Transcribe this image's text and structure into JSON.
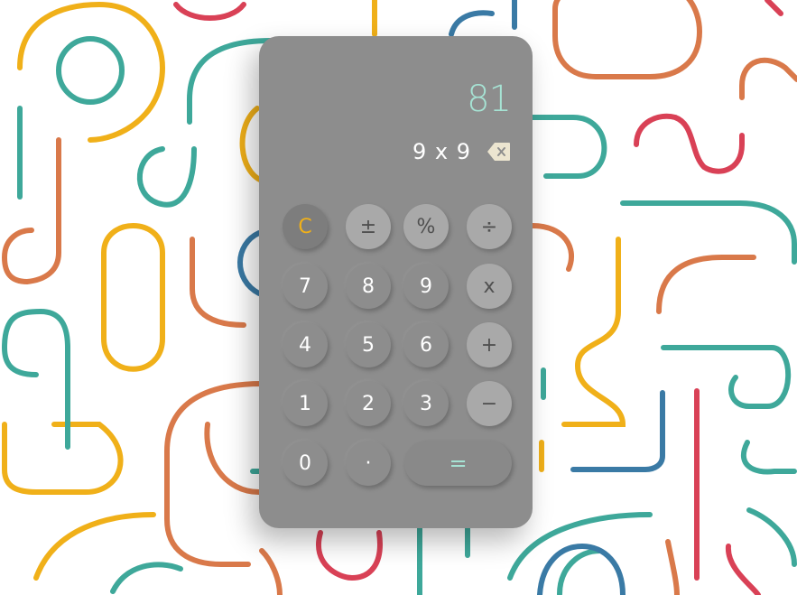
{
  "calculator": {
    "result": "81",
    "expression": "9 x 9",
    "backspace_icon": "backspace-icon",
    "colors": {
      "body": "#8d8d8d",
      "result_text": "#a6e3d4",
      "clear_key_text": "#f0b019",
      "equals_text": "#a6e3d4",
      "operator_key": "#a9a9a9"
    },
    "keys": {
      "clear": "C",
      "sign": "±",
      "percent": "%",
      "divide": "÷",
      "seven": "7",
      "eight": "8",
      "nine": "9",
      "multiply": "x",
      "four": "4",
      "five": "5",
      "six": "6",
      "add": "+",
      "one": "1",
      "two": "2",
      "three": "3",
      "subtract": "−",
      "zero": "0",
      "decimal": "·",
      "equals": "="
    }
  },
  "background": {
    "pattern": "colorful-line-pattern",
    "colors": [
      "#f0b019",
      "#3ea89a",
      "#d9794a",
      "#d94156",
      "#3a7aa5"
    ]
  }
}
